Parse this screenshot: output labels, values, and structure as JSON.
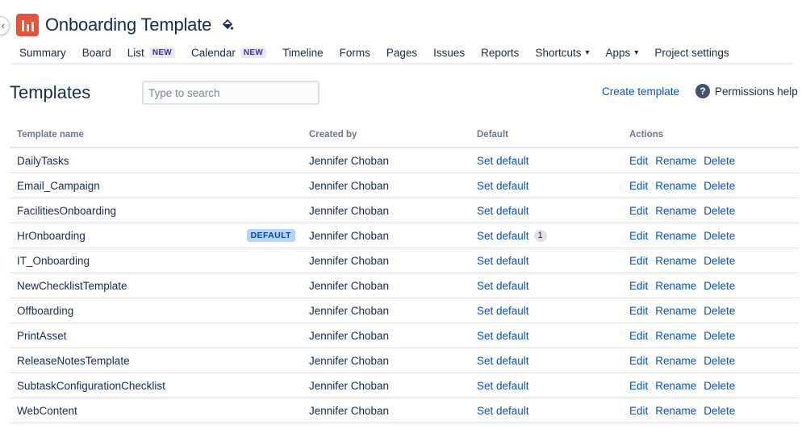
{
  "project": {
    "title": "Onboarding Template",
    "avatar_color": "#e5533d"
  },
  "tabs": [
    {
      "label": "Summary"
    },
    {
      "label": "Board"
    },
    {
      "label": "List",
      "badge": "NEW"
    },
    {
      "label": "Calendar",
      "badge": "NEW"
    },
    {
      "label": "Timeline"
    },
    {
      "label": "Forms"
    },
    {
      "label": "Pages"
    },
    {
      "label": "Issues"
    },
    {
      "label": "Reports"
    },
    {
      "label": "Shortcuts",
      "dropdown": true
    },
    {
      "label": "Apps",
      "dropdown": true
    },
    {
      "label": "Project settings"
    }
  ],
  "page": {
    "title": "Templates",
    "search_placeholder": "Type to search",
    "create_label": "Create template",
    "help_label": "Permissions help",
    "help_icon": "?"
  },
  "table": {
    "headers": {
      "name": "Template name",
      "created_by": "Created by",
      "default": "Default",
      "actions": "Actions"
    },
    "action_labels": {
      "edit": "Edit",
      "rename": "Rename",
      "delete": "Delete"
    },
    "set_default_label": "Set default",
    "default_badge": "DEFAULT",
    "rows": [
      {
        "name": "DailyTasks",
        "created_by": "Jennifer Choban"
      },
      {
        "name": "Email_Campaign",
        "created_by": "Jennifer Choban"
      },
      {
        "name": "FacilitiesOnboarding",
        "created_by": "Jennifer Choban"
      },
      {
        "name": "HrOnboarding",
        "created_by": "Jennifer Choban",
        "is_default": true,
        "count": "1"
      },
      {
        "name": "IT_Onboarding",
        "created_by": "Jennifer Choban"
      },
      {
        "name": "NewChecklistTemplate",
        "created_by": "Jennifer Choban"
      },
      {
        "name": "Offboarding",
        "created_by": "Jennifer Choban"
      },
      {
        "name": "PrintAsset",
        "created_by": "Jennifer Choban"
      },
      {
        "name": "ReleaseNotesTemplate",
        "created_by": "Jennifer Choban"
      },
      {
        "name": "SubtaskConfigurationChecklist",
        "created_by": "Jennifer Choban"
      },
      {
        "name": "WebContent",
        "created_by": "Jennifer Choban"
      }
    ]
  },
  "colors": {
    "link": "#0052cc",
    "text": "#172b4d",
    "muted": "#6b778c"
  }
}
